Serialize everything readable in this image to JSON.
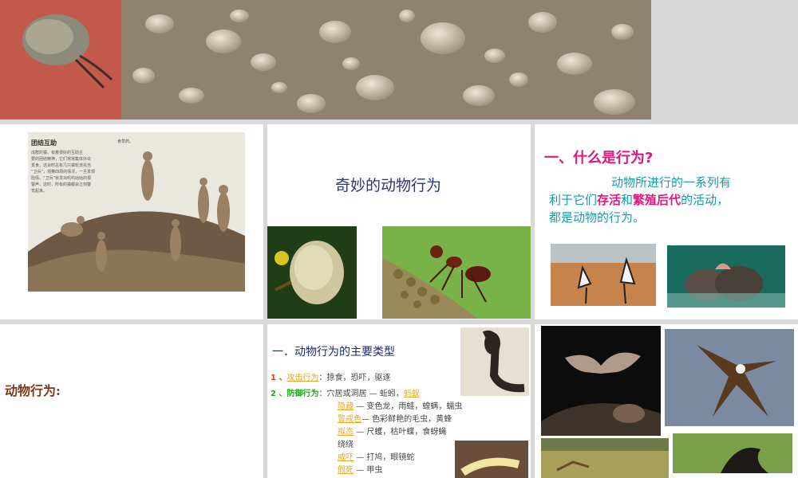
{
  "slides": {
    "meerkat_page": {
      "heading": "团结互助",
      "body_lines": [
        "成群的獴，有着很好的互助主",
        "要的团结精神，它们常常集体外出",
        "觅食，这会时总有几只獴轮流充当",
        "“卫兵”，观察四周的情况，一旦发现",
        "险情，“卫兵”就发出叽叽咕咕的报",
        "警声，这时，所有的獴都会立刻警",
        "觉起来。"
      ],
      "top_right_text": "食草药。"
    },
    "title_slide": {
      "title": "奇妙的动物行为"
    },
    "what_is": {
      "heading": "一、什么是行为?",
      "line1": "动物所进行的一系列有",
      "line2_a": "利于它们",
      "line2_b": "存活",
      "line2_c": "和",
      "line2_d": "繁殖后代",
      "line2_e": "的活动，",
      "line3": "都是动物的行为。"
    },
    "behavior_label": {
      "text": "动物行为:"
    },
    "types": {
      "heading": "一．动物行为的主要类型",
      "r1_num": "1 、",
      "r1_label": "攻击行为",
      "r1_text": "：掠食，恐吓，驱逐",
      "r2_num": "2 、",
      "r2_label": "防御行为",
      "r2_text": "：穴居或洞居 — 蚯蚓，",
      "r2_tail": "蚂蚁",
      "r3_label": "隐藏",
      "r3_text": " — 变色龙，雨蛙，蝗螨，蠕虫",
      "r4_label": "警戒色",
      "r4_text": "— 色彩鲜艳的毛虫，黄蜂",
      "r5_label": "拟态",
      "r5_text": " — 尺蠖，枯叶蝶，食蚜蝇",
      "r6_text": "绕绕",
      "r7_label": "威吓",
      "r7_text": " — 打鸠，眼镜蛇",
      "r8_label": "假死",
      "r8_text": " — 甲虫"
    }
  },
  "colors": {
    "magenta": "#e0187c",
    "teal": "#1d9aa8",
    "navy": "#1c2a6e",
    "green_label": "#1aa81a",
    "red_label": "#e53a1c",
    "orange_label": "#e6a91c",
    "brown_title": "#7a3a1a"
  }
}
